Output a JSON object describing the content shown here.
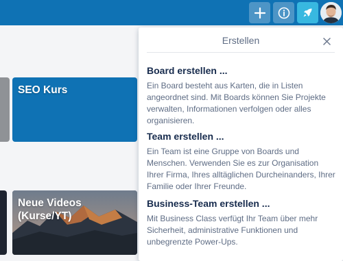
{
  "header": {
    "buttons": [
      {
        "name": "create",
        "icon": "plus-icon"
      },
      {
        "name": "info",
        "icon": "info-icon"
      },
      {
        "name": "notifications",
        "icon": "rocket-icon"
      }
    ],
    "avatar": "avatar"
  },
  "boards": [
    {
      "title": "SEO Kurs",
      "color": "#0f72b4"
    },
    {
      "title": "Neue Videos (Kurse/YT)",
      "background": "mountain-photo"
    }
  ],
  "popover": {
    "title": "Erstellen",
    "close_icon": "close-icon",
    "options": [
      {
        "heading": "Board erstellen ...",
        "description": "Ein Board besteht aus Karten, die in Listen angeordnet sind. Mit Boards können Sie Projekte verwalten, Informationen verfolgen oder alles organisieren."
      },
      {
        "heading": "Team erstellen ...",
        "description": "Ein Team ist eine Gruppe von Boards und Menschen. Verwenden Sie es zur Organisation Ihrer Firma, Ihres alltäglichen Durcheinanders, Ihrer Familie oder Ihrer Freunde."
      },
      {
        "heading": "Business-Team erstellen ...",
        "description": "Mit Business Class verfügt Ihr Team über mehr Sicherheit, administrative Funktionen und unbegrenzte Power-Ups."
      }
    ]
  },
  "colors": {
    "header": "#0f72b4",
    "accent_button": "#38b8e0",
    "heading_text": "#172b4d",
    "body_text": "#5e6c84"
  }
}
